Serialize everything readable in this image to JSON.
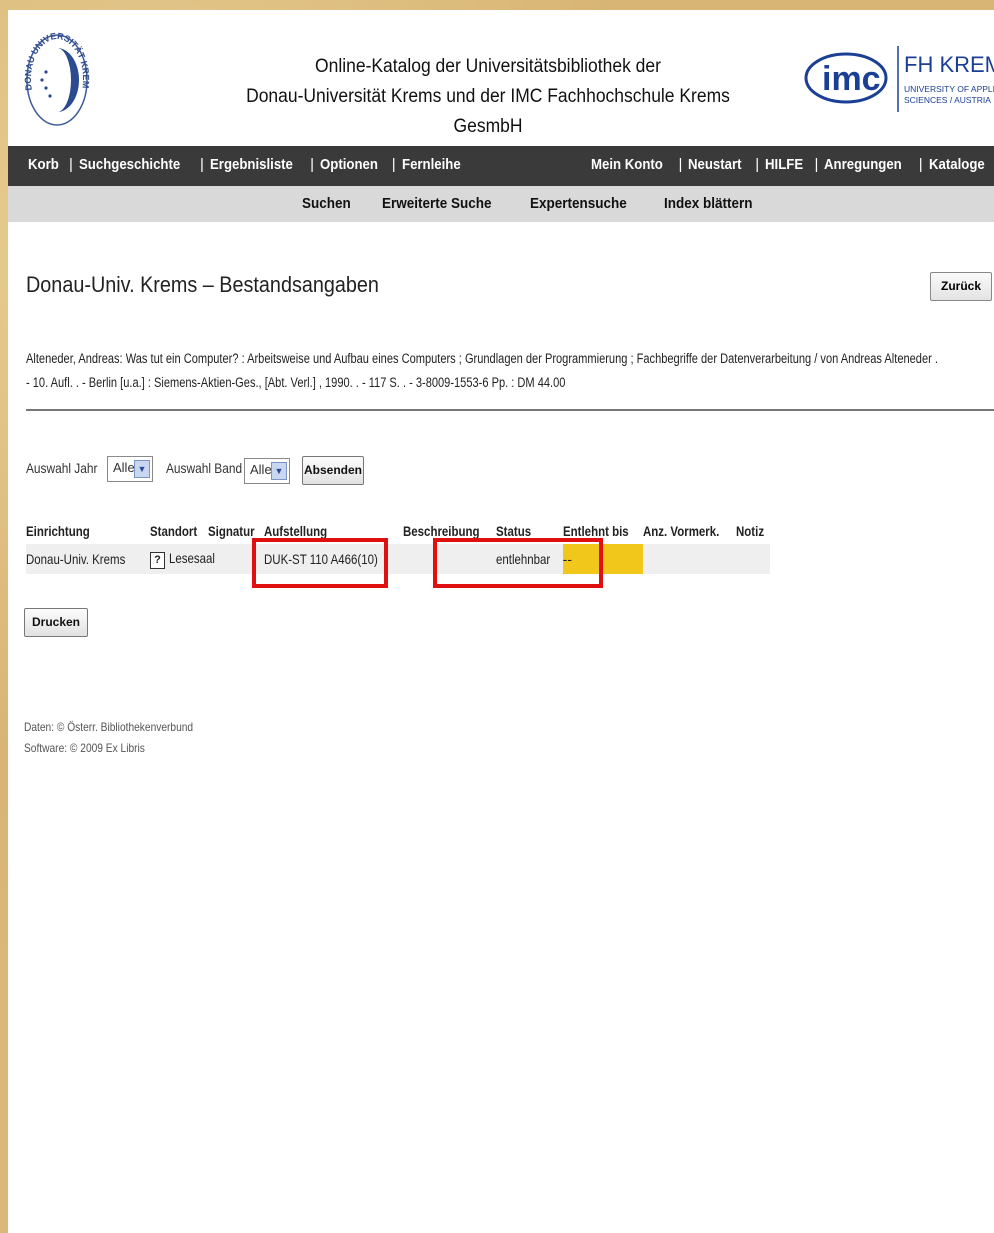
{
  "header": {
    "title_line1": "Online-Katalog der Universitätsbibliothek der",
    "title_line2": "Donau-Universität Krems und der IMC Fachhochschule Krems GesmbH",
    "seal_text": "DONAU UNIVERSITÄT KREMS",
    "imc_logo_text": "imc",
    "fh_name": "FH KREMS",
    "fh_sub1": "UNIVERSITY OF APPLIED",
    "fh_sub2": "SCIENCES / AUSTRIA"
  },
  "topnav": {
    "left": [
      "Korb",
      "Suchgeschichte",
      "Ergebnisliste",
      "Optionen",
      "Fernleihe"
    ],
    "right": [
      "Mein Konto",
      "Neustart",
      "HILFE",
      "Anregungen",
      "Kataloge"
    ]
  },
  "subnav": [
    "Suchen",
    "Erweiterte Suche",
    "Expertensuche",
    "Index blättern"
  ],
  "page_title": "Donau-Univ. Krems – Bestandsangaben",
  "back_button": "Zurück",
  "biblio": {
    "line1": "Alteneder, Andreas: Was tut ein Computer? : Arbeitsweise und Aufbau eines Computers ; Grundlagen der Programmierung ; Fachbegriffe der Datenverarbeitung / von Andreas Alteneder .",
    "line2": "- 10. Aufl. . - Berlin [u.a.] : Siemens-Aktien-Ges., [Abt. Verl.] , 1990. . - 117 S. . - 3-8009-1553-6 Pp. : DM 44.00"
  },
  "filter": {
    "year_label": "Auswahl Jahr",
    "year_value": "Alle",
    "volume_label": "Auswahl Band",
    "volume_value": "Alle",
    "submit_label": "Absenden"
  },
  "table": {
    "headers": [
      "Einrichtung",
      "Standort",
      "Signatur",
      "Aufstellung",
      "Beschreibung",
      "Status",
      "Entlehnt bis",
      "Anz. Vormerk.",
      "Notiz"
    ],
    "rows": [
      {
        "einrichtung": "Donau-Univ. Krems",
        "help": "?",
        "standort": "Lesesaal",
        "aufstellung": "DUK-ST 110 A466(10)",
        "beschreibung": "",
        "status": "entlehnbar",
        "entlehnt_bis": "--",
        "vormerk": "",
        "notiz": ""
      }
    ]
  },
  "print_button": "Drucken",
  "footer": {
    "data_line": "Daten: © Österr. Bibliothekenverbund",
    "software_line": "Software: © 2009 Ex Libris"
  },
  "colors": {
    "highlight_box": "#e01010",
    "due_cell": "#f2c71c",
    "nav_bg": "#3a3a3a",
    "subnav_bg": "#d9d9d9",
    "imc_blue": "#1b3f95"
  }
}
